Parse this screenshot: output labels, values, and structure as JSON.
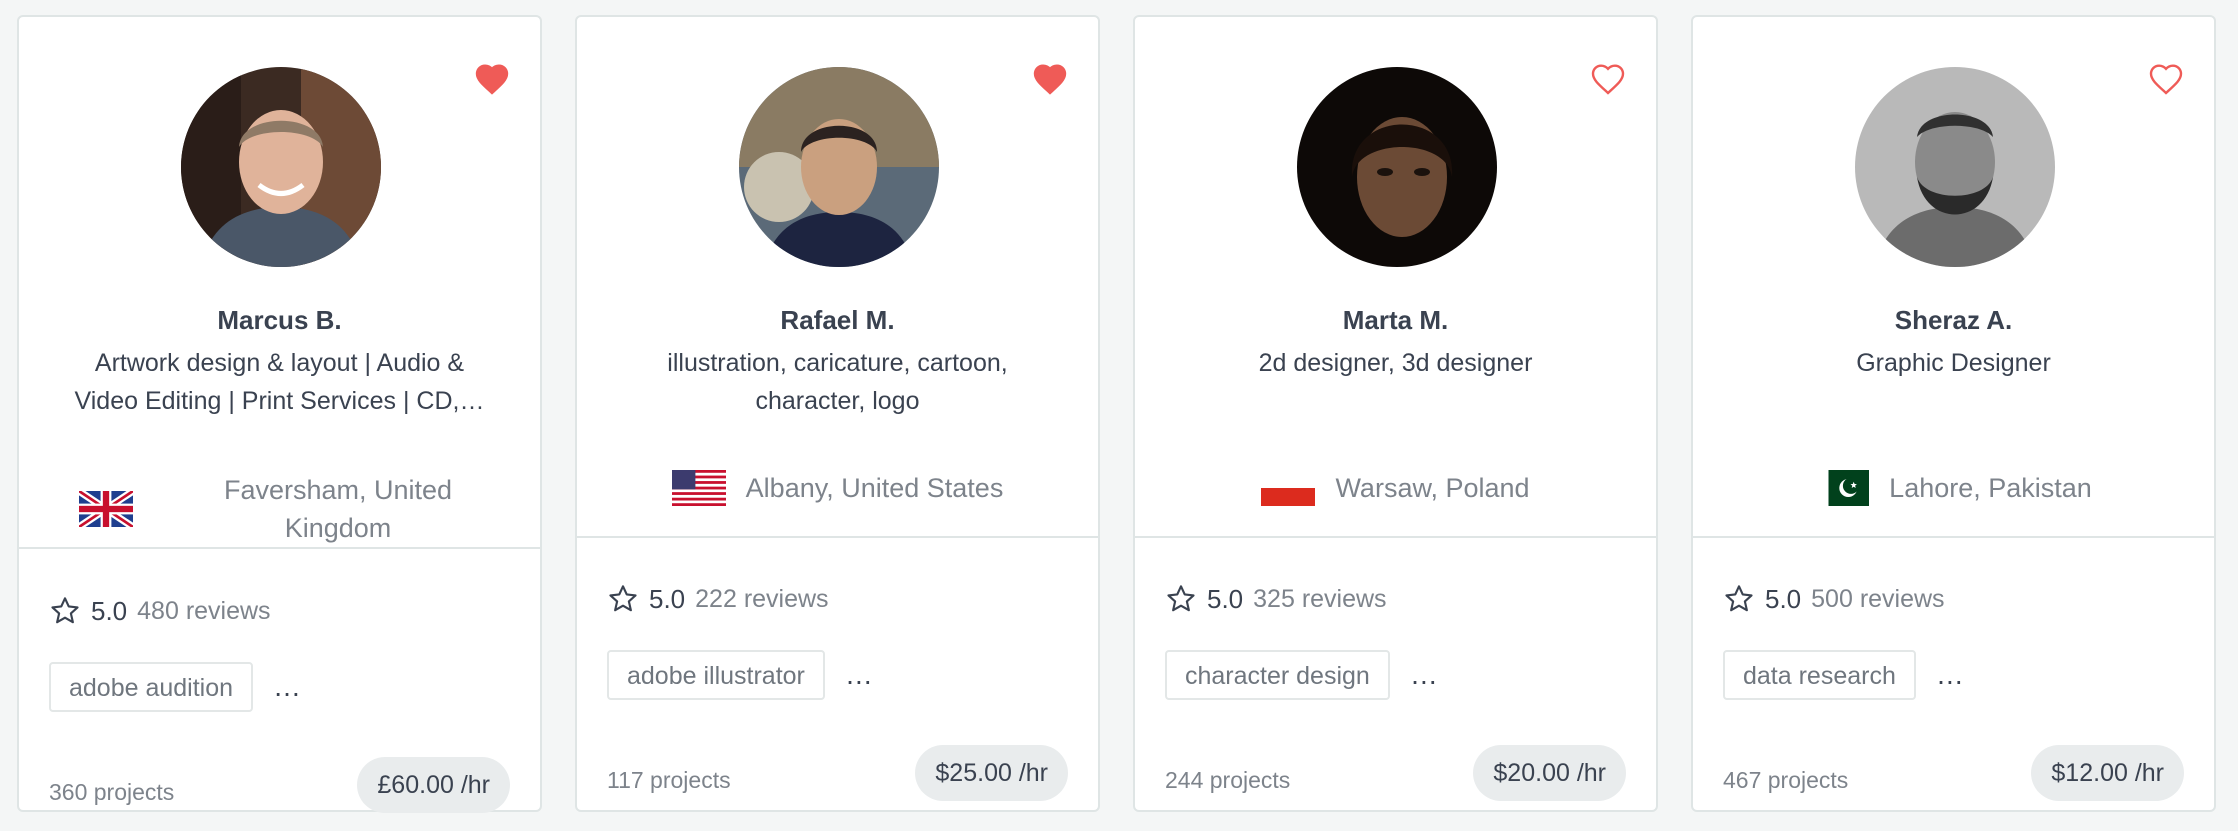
{
  "freelancers": [
    {
      "name": "Marcus B.",
      "title": "Artwork design & layout | Audio & Video Editing | Print Services | CD,…",
      "location": "Faversham, United Kingdom",
      "flag": "uk-flag-icon",
      "favorited": true,
      "rating": "5.0",
      "reviews": "480 reviews",
      "skill": "adobe audition",
      "more": "…",
      "projects": "360 projects",
      "rate": "£60.00 /hr"
    },
    {
      "name": "Rafael M.",
      "title": "illustration, caricature, cartoon, character, logo",
      "location": "Albany, United States",
      "flag": "us-flag-icon",
      "favorited": true,
      "rating": "5.0",
      "reviews": "222 reviews",
      "skill": "adobe illustrator",
      "more": "…",
      "projects": "117 projects",
      "rate": "$25.00 /hr"
    },
    {
      "name": "Marta M.",
      "title": "2d designer, 3d designer",
      "location": "Warsaw, Poland",
      "flag": "poland-flag-icon",
      "favorited": false,
      "rating": "5.0",
      "reviews": "325 reviews",
      "skill": "character design",
      "more": "…",
      "projects": "244 projects",
      "rate": "$20.00 /hr"
    },
    {
      "name": "Sheraz A.",
      "title": "Graphic Designer",
      "location": "Lahore, Pakistan",
      "flag": "pakistan-flag-icon",
      "favorited": false,
      "rating": "5.0",
      "reviews": "500 reviews",
      "skill": "data research",
      "more": "…",
      "projects": "467 projects",
      "rate": "$12.00 /hr"
    }
  ],
  "colors": {
    "favorite": "#ef5b57",
    "card_border": "#dfe5e5",
    "background": "#f4f6f6",
    "rate_pill": "#e9eced"
  }
}
